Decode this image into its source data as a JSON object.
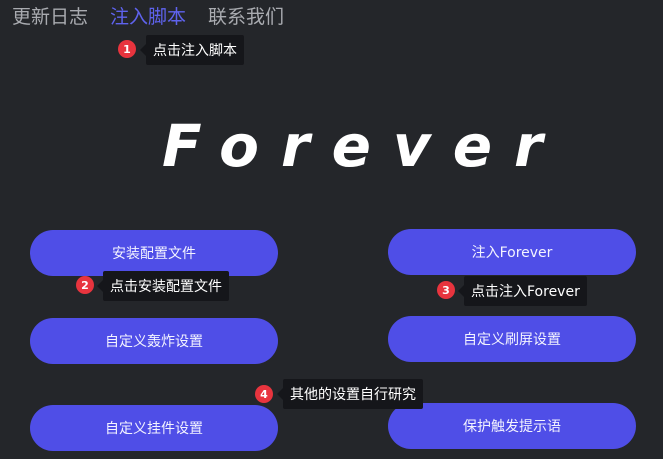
{
  "tabs": [
    {
      "label": "更新日志",
      "active": false
    },
    {
      "label": "注入脚本",
      "active": true
    },
    {
      "label": "联系我们",
      "active": false
    }
  ],
  "hero_title": "Forever",
  "buttons": {
    "install_config": "安装配置文件",
    "inject": "注入Forever",
    "custom_bomb": "自定义轰炸设置",
    "custom_refresh": "自定义刷屏设置",
    "custom_hook": "自定义挂件设置",
    "protect_trigger": "保护触发提示语"
  },
  "guides": [
    {
      "number": "1",
      "text": "点击注入脚本"
    },
    {
      "number": "2",
      "text": "点击安装配置文件"
    },
    {
      "number": "3",
      "text": "点击注入Forever"
    },
    {
      "number": "4",
      "text": "其他的设置自行研究"
    }
  ],
  "colors": {
    "background": "#24262a",
    "accent": "#4f4ee7",
    "active_tab": "#5f63ee",
    "marker": "#e8343e",
    "tooltip": "#15161a"
  }
}
